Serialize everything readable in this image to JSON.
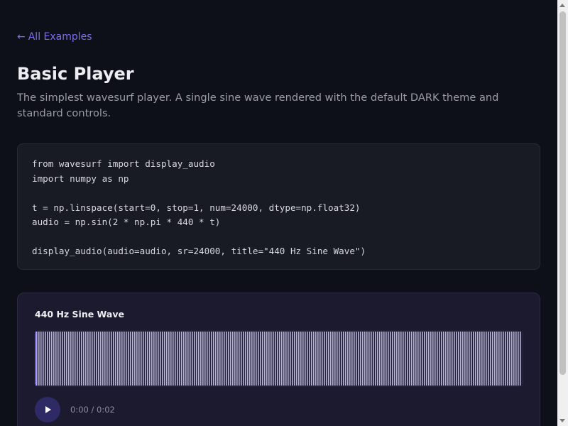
{
  "nav": {
    "back_arrow": "←",
    "back_label": "All Examples"
  },
  "header": {
    "title": "Basic Player",
    "description": "The simplest wavesurf player. A single sine wave rendered with the default DARK theme and standard controls."
  },
  "code": {
    "lines": [
      "from wavesurf import display_audio",
      "import numpy as np",
      "",
      "t = np.linspace(start=0, stop=1, num=24000, dtype=np.float32)",
      "audio = np.sin(2 * np.pi * 440 * t)",
      "",
      "display_audio(audio=audio, sr=24000, title=\"440 Hz Sine Wave\")"
    ]
  },
  "player": {
    "title": "440 Hz Sine Wave",
    "time_current": "0:00",
    "time_separator": " / ",
    "time_total": "0:02",
    "progress": 0,
    "wave_color": "#b4b2d2",
    "progress_color": "#6b5ce0",
    "play_icon": "play-icon"
  },
  "theme": {
    "background": "#0e1019",
    "accent": "#7b6ef2"
  }
}
